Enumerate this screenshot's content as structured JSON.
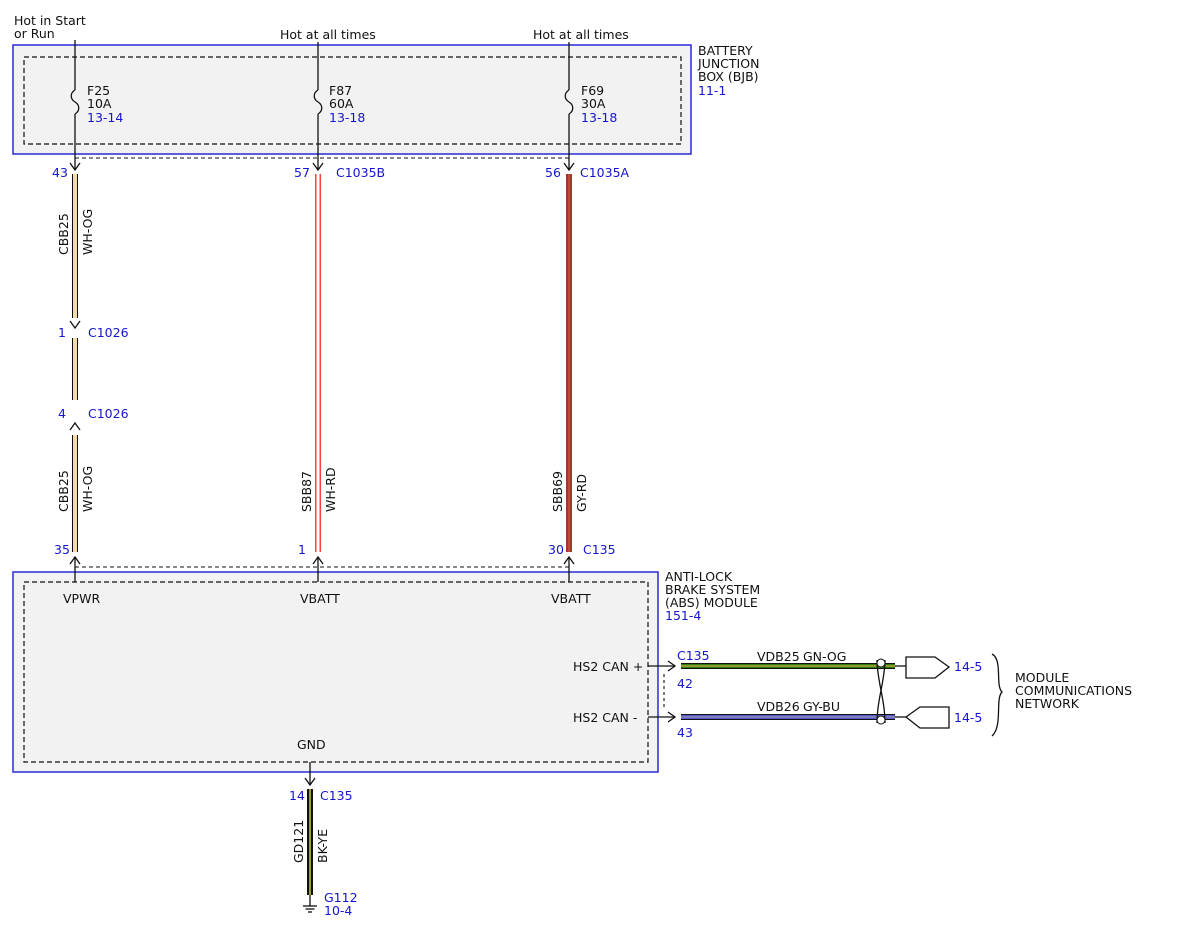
{
  "colors": {
    "module_border": "#2a2ad6",
    "module_fill": "#f2f2f2",
    "ref_text": "#1515d0",
    "wire_wh_og": "#f3dcaa",
    "wire_wh_rd": "#ff4040",
    "wire_gy_rd": "#9b3a2e",
    "wire_gn_og": "#2f7d10",
    "wire_gy_bu": "#5a5ad0",
    "wire_bk_ye": "#2a2a00"
  },
  "feeds": {
    "left_line1": "Hot in Start",
    "left_line2": "or Run",
    "middle": "Hot at all times",
    "right": "Hot at all times"
  },
  "bjb": {
    "title1": "BATTERY",
    "title2": "JUNCTION",
    "title3": "BOX (BJB)",
    "ref": "11-1",
    "fuses": [
      {
        "name": "F25",
        "rating": "10A",
        "ref": "13-14"
      },
      {
        "name": "F87",
        "rating": "60A",
        "ref": "13-18"
      },
      {
        "name": "F69",
        "rating": "30A",
        "ref": "13-18"
      }
    ]
  },
  "wires": {
    "left_top": {
      "pin": "43",
      "circuit": "CBB25",
      "color_code": "WH-OG"
    },
    "left_inline_pin_a": "1",
    "left_inline_connector_a": "C1026",
    "left_inline_pin_b": "4",
    "left_inline_connector_b": "C1026",
    "left_bottom": {
      "pin": "35",
      "circuit": "CBB25",
      "color_code": "WH-OG"
    },
    "middle": {
      "top_pin": "57",
      "top_connector": "C1035B",
      "circuit": "SBB87",
      "color_code": "WH-RD",
      "bottom_pin": "1"
    },
    "right": {
      "top_pin": "56",
      "top_connector": "C1035A",
      "circuit": "SBB69",
      "color_code": "GY-RD",
      "bottom_pin": "30",
      "bottom_connector": "C135"
    }
  },
  "abs": {
    "title1": "ANTI-LOCK",
    "title2": "BRAKE SYSTEM",
    "title3": "(ABS) MODULE",
    "ref": "151-4",
    "pin_labels": [
      "VPWR",
      "VBATT",
      "VBATT"
    ],
    "can_plus": "HS2 CAN +",
    "can_minus": "HS2 CAN -",
    "gnd": "GND"
  },
  "network": {
    "connector": "C135",
    "plus_pin": "42",
    "minus_pin": "43",
    "plus_circuit": "VDB25",
    "plus_color": "GN-OG",
    "minus_circuit": "VDB26",
    "minus_color": "GY-BU",
    "plus_ref": "14-5",
    "minus_ref": "14-5",
    "label1": "MODULE",
    "label2": "COMMUNICATIONS",
    "label3": "NETWORK"
  },
  "ground": {
    "pin": "14",
    "connector": "C135",
    "circuit": "GD121",
    "color_code": "BK-YE",
    "point": "G112",
    "ref": "10-4"
  }
}
